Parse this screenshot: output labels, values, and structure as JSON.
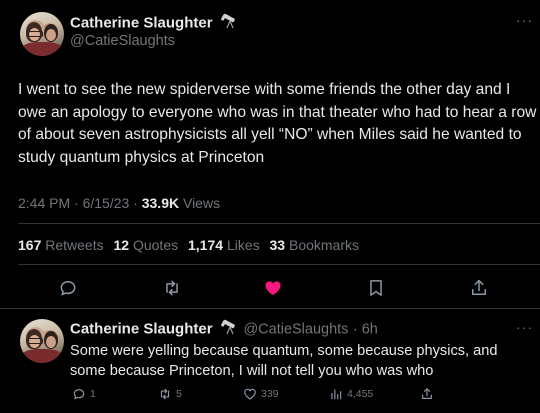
{
  "tweet": {
    "author_name": "Catherine Slaughter",
    "author_handle": "@CatieSlaughts",
    "text": "I went to see the new spiderverse with some friends the other day and I owe an apology to everyone who was in that theater who had to hear a row of about seven astrophysicists all yell “NO” when Miles said he wanted to study quantum physics at Princeton",
    "time": "2:44 PM · 6/15/23 · ",
    "views_count": "33.9K",
    "views_label": " Views",
    "stats": {
      "retweets_count": "167",
      "retweets_label": "Retweets",
      "quotes_count": "12",
      "quotes_label": "Quotes",
      "likes_count": "1,174",
      "likes_label": "Likes",
      "bookmarks_count": "33",
      "bookmarks_label": "Bookmarks"
    },
    "more_label": "···"
  },
  "reply": {
    "author_name": "Catherine Slaughter",
    "author_handle": "@CatieSlaughts",
    "age": "· 6h",
    "text": "Some were yelling because quantum, some because physics, and some because Princeton, I will not tell you who was who",
    "reply_count": "1",
    "retweet_count": "5",
    "like_count": "339",
    "views_count": "4,455",
    "more_label": "···"
  },
  "icons": {
    "telescope": "telescope-icon",
    "reply": "reply-icon",
    "retweet": "retweet-icon",
    "like": "heart-icon",
    "bookmark": "bookmark-icon",
    "share": "share-icon",
    "views": "views-icon"
  },
  "colors": {
    "background": "#000000",
    "text_primary": "#e7e9ea",
    "text_secondary": "#71767b",
    "like_active": "#f91880",
    "divider": "#2f3336"
  }
}
